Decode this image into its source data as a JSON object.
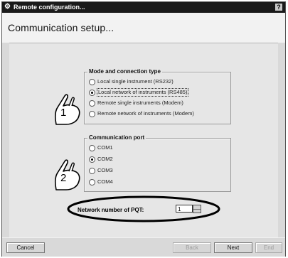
{
  "window": {
    "title": "Remote configuration...",
    "help_label": "?"
  },
  "page": {
    "title": "Communication setup..."
  },
  "mode_group": {
    "title": "Mode and connection type",
    "options": [
      {
        "label": "Local single instrument (RS232)",
        "selected": false
      },
      {
        "label": "Local network of instruments (RS485)",
        "selected": true
      },
      {
        "label": "Remote single instruments (Modem)",
        "selected": false
      },
      {
        "label": "Remote network of instruments (Modem)",
        "selected": false
      }
    ]
  },
  "port_group": {
    "title": "Communication port",
    "options": [
      {
        "label": "COM1",
        "selected": false
      },
      {
        "label": "COM2",
        "selected": true
      },
      {
        "label": "COM3",
        "selected": false
      },
      {
        "label": "COM4",
        "selected": false
      }
    ]
  },
  "callouts": {
    "one": "1",
    "two": "2"
  },
  "network": {
    "label": "Network number of PQT:",
    "value": "1"
  },
  "buttons": {
    "cancel": "Cancel",
    "back": "Back",
    "next": "Next",
    "end": "End"
  }
}
